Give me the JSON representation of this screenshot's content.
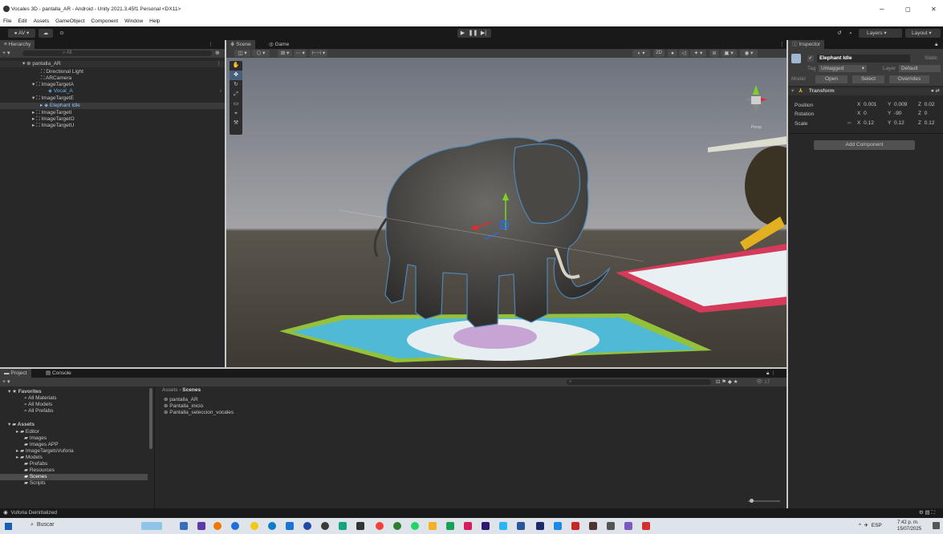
{
  "window": {
    "title": "Vocales 3D - pantalla_AR - Android - Unity 2021.3.45f1 Personal <DX11>",
    "controls": [
      "–",
      "◻",
      "✕"
    ]
  },
  "menu": [
    "File",
    "Edit",
    "Assets",
    "GameObject",
    "Component",
    "Window",
    "Help"
  ],
  "toolbar": {
    "account": "AV ▾",
    "layers": "Layers",
    "layout": "Layout"
  },
  "hierarchy": {
    "tab": "Hierarchy",
    "search_placeholder": "All",
    "scene": "pantalla_AR",
    "items": [
      "Directional Light",
      "ARCamera",
      "ImageTargetA",
      "Vocal_A",
      "ImageTargetE",
      "Elephant Idle",
      "ImageTargetI",
      "ImageTargetO",
      "ImageTargetU"
    ]
  },
  "scene": {
    "tabs": [
      "Scene",
      "Game"
    ],
    "toggle_2d": "2D",
    "view_label": "Persp"
  },
  "inspector": {
    "tab": "Inspector",
    "object_name": "Elephant Idle",
    "static_label": "Static",
    "tag_label": "Tag",
    "tag_value": "Untagged",
    "layer_label": "Layer",
    "layer_value": "Default",
    "model_label": "Model",
    "open_btn": "Open",
    "select_btn": "Select",
    "overrides_btn": "Overrides",
    "transform_title": "Transform",
    "position_label": "Position",
    "rotation_label": "Rotation",
    "scale_label": "Scale",
    "position": {
      "x": "0.001",
      "y": "0.009",
      "z": "0.02"
    },
    "rotation": {
      "x": "0",
      "y": "-90",
      "z": "0"
    },
    "scale": {
      "x": "0.12",
      "y": "0.12",
      "z": "0.12"
    },
    "add_component": "Add Component"
  },
  "project": {
    "tabs": [
      "Project",
      "Console"
    ],
    "favorites": "Favorites",
    "fav_items": [
      "All Materials",
      "All Models",
      "All Prefabs"
    ],
    "assets": "Assets",
    "asset_folders": [
      "Editor",
      "Images",
      "Images APP",
      "ImageTargetsVuforia",
      "Models",
      "Prefabs",
      "Resources",
      "Scenes",
      "Scripts"
    ],
    "breadcrumb_root": "Assets",
    "breadcrumb_current": "Scenes",
    "scenes": [
      "pantalla_AR",
      "Pantalla_inicio",
      "Pantalla_seleccion_vocales"
    ],
    "hidden_count": "17"
  },
  "status": {
    "message": "Vuforia DeinitIalized"
  },
  "taskbar": {
    "search_placeholder": "Buscar",
    "lang": "ESP",
    "time": "7:42 p. m.",
    "date": "15/07/2025"
  },
  "colors": {
    "selection": "#2c5d87",
    "panel": "#282828",
    "toolbar": "#191919",
    "sky": "#8f8f95",
    "ground": "#4a463f"
  }
}
